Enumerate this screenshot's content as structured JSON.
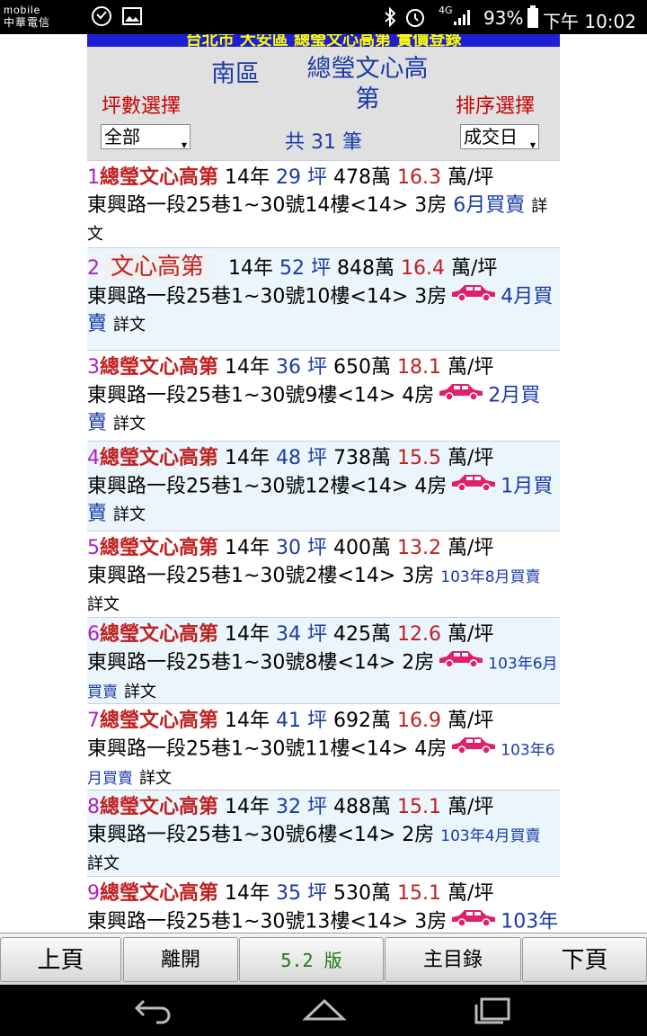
{
  "status": {
    "carrier_top": "mobile",
    "carrier_bottom": "中華電信",
    "network": "4G",
    "battery": "93%",
    "time": "下午 10:02"
  },
  "header": {
    "top_band": "台北市 大安區 總瑩文心高第 實價登錄",
    "region": "南區",
    "title": "總瑩文心高第",
    "area_label": "坪數選擇",
    "sort_label": "排序選擇",
    "area_select": "全部",
    "sort_select": "成交日",
    "count": "共 31 筆"
  },
  "units": {
    "ping": "坪",
    "wan": "萬",
    "per_ping": "萬/坪",
    "detail": "詳文"
  },
  "listings": [
    {
      "num": "1",
      "name": "總瑩文心高第",
      "age": "14年",
      "area": "29",
      "total": "478萬",
      "unit_price": "16.3",
      "address": "東興路一段25巷1~30號14樓<14>",
      "rooms": "3房",
      "date": "6月買賣",
      "parking": false
    },
    {
      "num": "2",
      "name": "文心高第",
      "age": "14年",
      "area": "52",
      "total": "848萬",
      "unit_price": "16.4",
      "address": "東興路一段25巷1~30號10樓<14>",
      "rooms": "3房",
      "date": "4月買賣",
      "parking": true
    },
    {
      "num": "3",
      "name": "總瑩文心高第",
      "age": "14年",
      "area": "36",
      "total": "650萬",
      "unit_price": "18.1",
      "address": "東興路一段25巷1~30號9樓<14>",
      "rooms": "4房",
      "date": "2月買賣",
      "parking": true
    },
    {
      "num": "4",
      "name": "總瑩文心高第",
      "age": "14年",
      "area": "48",
      "total": "738萬",
      "unit_price": "15.5",
      "address": "東興路一段25巷1~30號12樓<14>",
      "rooms": "4房",
      "date": "1月買賣",
      "parking": true
    },
    {
      "num": "5",
      "name": "總瑩文心高第",
      "age": "14年",
      "area": "30",
      "total": "400萬",
      "unit_price": "13.2",
      "address": "東興路一段25巷1~30號2樓<14>",
      "rooms": "3房",
      "date": "103年8月買賣",
      "parking": false
    },
    {
      "num": "6",
      "name": "總瑩文心高第",
      "age": "14年",
      "area": "34",
      "total": "425萬",
      "unit_price": "12.6",
      "address": "東興路一段25巷1~30號8樓<14>",
      "rooms": "2房",
      "date": "103年6月買賣",
      "parking": true
    },
    {
      "num": "7",
      "name": "總瑩文心高第",
      "age": "14年",
      "area": "41",
      "total": "692萬",
      "unit_price": "16.9",
      "address": "東興路一段25巷1~30號11樓<14>",
      "rooms": "4房",
      "date": "103年6月買賣",
      "parking": true
    },
    {
      "num": "8",
      "name": "總瑩文心高第",
      "age": "14年",
      "area": "32",
      "total": "488萬",
      "unit_price": "15.1",
      "address": "東興路一段25巷1~30號6樓<14>",
      "rooms": "2房",
      "date": "103年4月買賣",
      "parking": false
    },
    {
      "num": "9",
      "name": "總瑩文心高第",
      "age": "14年",
      "area": "35",
      "total": "530萬",
      "unit_price": "15.1",
      "address": "東興路一段25巷1~30號13樓<14>",
      "rooms": "3房",
      "date": "103年",
      "parking": true
    }
  ],
  "toolbar": {
    "prev": "上頁",
    "leave": "離開",
    "version": "5.2 版",
    "menu": "主目錄",
    "next": "下頁"
  },
  "colors": {
    "band": "#1e1ed2",
    "header_bg": "#e0e0e0",
    "name": "#c02020",
    "area": "#1a3aa8",
    "number": "#b020c0",
    "car": "#e0206a",
    "version": "#1a7a1a"
  }
}
